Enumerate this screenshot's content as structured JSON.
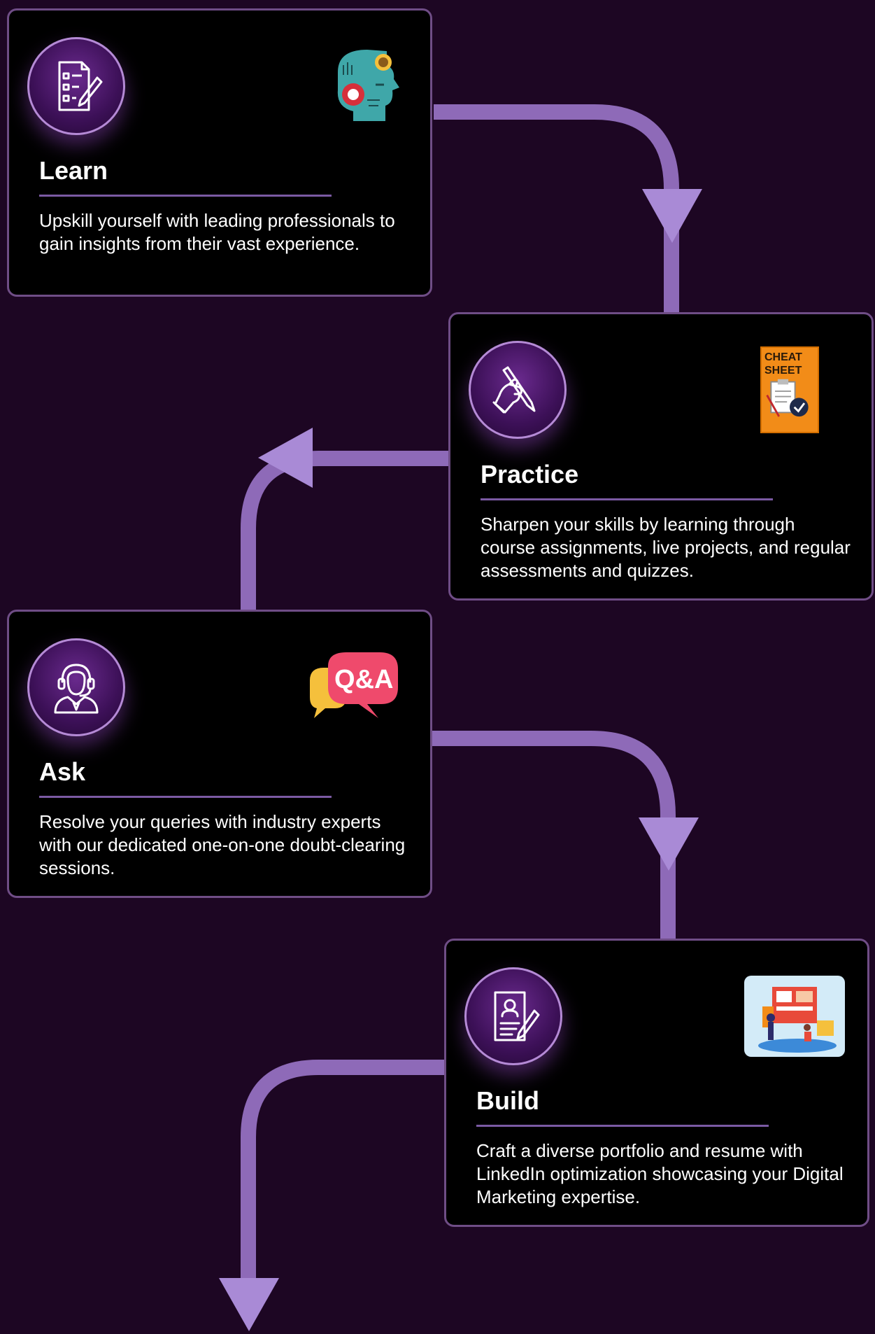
{
  "steps": [
    {
      "title": "Learn",
      "description": "Upskill yourself with leading professionals to gain insights from their vast experience.",
      "icon": "checklist-pencil-icon",
      "illustration": "head-puzzle-gear-icon"
    },
    {
      "title": "Practice",
      "description": "Sharpen your skills by learning through course assignments, live projects, and regular assessments and quizzes.",
      "icon": "hand-writing-pen-icon",
      "illustration": "cheat-sheet-icon",
      "illustration_text": "CHEAT SHEET"
    },
    {
      "title": "Ask",
      "description": "Resolve your queries with industry experts with our dedicated one-on-one doubt-clearing sessions.",
      "icon": "headset-support-agent-icon",
      "illustration": "qa-speech-bubbles-icon",
      "illustration_text": "Q&A"
    },
    {
      "title": "Build",
      "description": "Craft a diverse portfolio and resume with LinkedIn optimization showcasing your Digital Marketing expertise.",
      "icon": "resume-document-pen-icon",
      "illustration": "portfolio-board-icon"
    }
  ],
  "colors": {
    "background": "#1d0623",
    "card": "#000000",
    "card_border": "#6f4d86",
    "accent": "#9b78c9",
    "cheat_sheet": "#f28c18",
    "qa_pink": "#ef4a6c",
    "qa_yellow": "#f5c03c"
  }
}
